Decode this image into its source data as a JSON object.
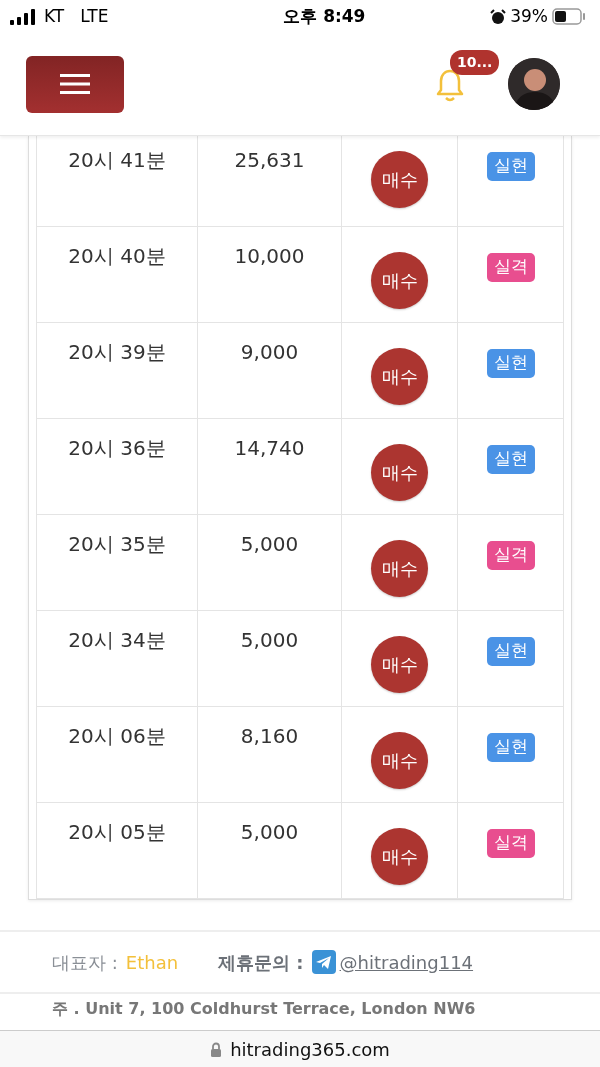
{
  "status_bar": {
    "carrier": "KT",
    "network": "LTE",
    "time": "오후 8:49",
    "battery": "39%"
  },
  "header": {
    "notification_count": "10..."
  },
  "rows": [
    {
      "time": "20시 41분",
      "amount": "25,631",
      "action": "매수",
      "result": "실현",
      "color": "#4a93e6"
    },
    {
      "time": "20시 40분",
      "amount": "10,000",
      "action": "매수",
      "result": "실격",
      "color": "#e84e8f"
    },
    {
      "time": "20시 39분",
      "amount": "9,000",
      "action": "매수",
      "result": "실현",
      "color": "#4a93e6"
    },
    {
      "time": "20시 36분",
      "amount": "14,740",
      "action": "매수",
      "result": "실현",
      "color": "#4a93e6"
    },
    {
      "time": "20시 35분",
      "amount": "5,000",
      "action": "매수",
      "result": "실격",
      "color": "#e84e8f"
    },
    {
      "time": "20시 34분",
      "amount": "5,000",
      "action": "매수",
      "result": "실현",
      "color": "#4a93e6"
    },
    {
      "time": "20시 06분",
      "amount": "8,160",
      "action": "매수",
      "result": "실현",
      "color": "#4a93e6"
    },
    {
      "time": "20시 05분",
      "amount": "5,000",
      "action": "매수",
      "result": "실격",
      "color": "#e84e8f"
    }
  ],
  "footer": {
    "representative_label": "대표자 :",
    "representative": "Ethan",
    "partner_label": "제휴문의 :",
    "partner_link": "@hitrading114",
    "address": "주 . Unit 7, 100 Coldhurst Terrace, London NW6"
  },
  "browser": {
    "url": "hitrading365.com"
  }
}
